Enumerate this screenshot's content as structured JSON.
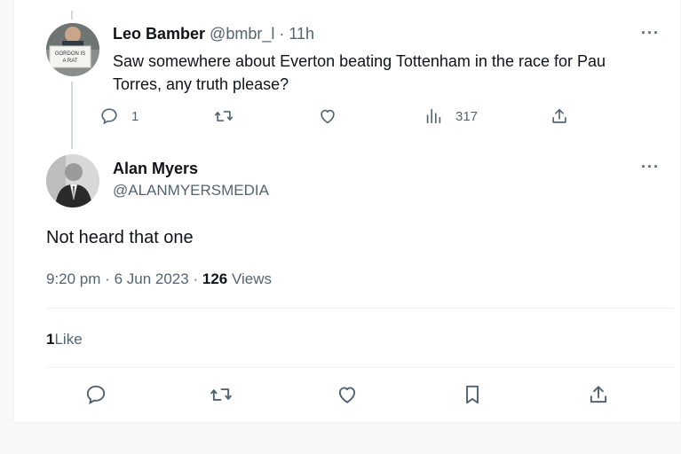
{
  "reply": {
    "author_name": "Leo Bamber",
    "author_handle": "@bmbr_l",
    "separator": "·",
    "time": "11h",
    "text": "Saw somewhere about Everton beating Tottenham in the race for Pau Torres, any truth please?",
    "avatar_sign_text": "GORDON IS A RAT",
    "more_icon": "more-dots-icon",
    "actions": {
      "reply_count": "1",
      "views_count": "317"
    }
  },
  "tweet": {
    "author_name": "Alan Myers",
    "author_handle": "@ALANMYERSMEDIA",
    "text": "Not heard that one",
    "time": "9:20 pm",
    "date_sep": "·",
    "date": "6 Jun 2023",
    "views_sep": "·",
    "views_count": "126",
    "views_label": "Views",
    "likes_count": "1",
    "likes_label": "Like"
  },
  "colors": {
    "text": "#0f1419",
    "muted": "#536471",
    "thread_line": "#cfd9de",
    "divider": "#eff3f4"
  },
  "icons": [
    "reply-icon",
    "retweet-icon",
    "like-icon",
    "views-icon",
    "share-icon",
    "bookmark-icon",
    "more-dots-icon"
  ]
}
